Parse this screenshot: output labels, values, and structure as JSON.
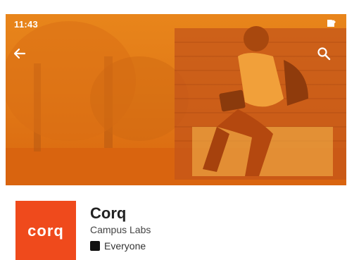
{
  "status_bar": {
    "time": "11:43",
    "icons": [
      "location-icon",
      "wifi-icon",
      "signal-icon",
      "battery-icon"
    ]
  },
  "toolbar": {
    "back_icon": "arrow-left-icon",
    "search_icon": "search-icon"
  },
  "app": {
    "icon_text": "corq",
    "name": "Corq",
    "developer": "Campus Labs",
    "content_rating": "Everyone"
  },
  "colors": {
    "hero_orange": "#e27a17",
    "brand_orange": "#ef4a1c"
  }
}
